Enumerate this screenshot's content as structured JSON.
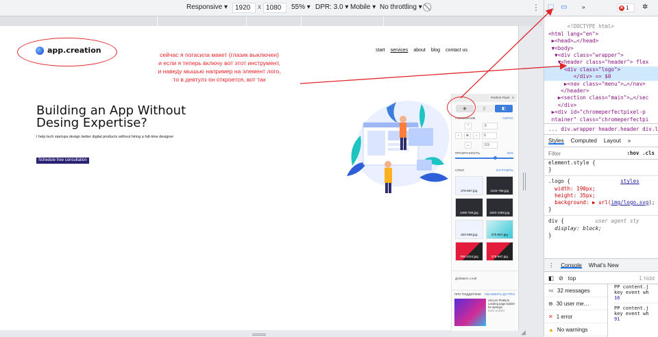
{
  "device_toolbar": {
    "mode": "Responsive ▾",
    "width": "1920",
    "times": "x",
    "height": "1080",
    "zoom": "55% ▾",
    "dpr": "DPR: 3.0 ▾",
    "device": "Mobile ▾",
    "throttle": "No throttling ▾"
  },
  "site": {
    "logo": "app.creation",
    "nav": [
      "start",
      "services",
      "about",
      "blog",
      "contact us"
    ],
    "hero_title": "Building an App Without Desing Expertise?",
    "hero_sub": "I help tech startups design better digital products without hiring a full-time designer",
    "cta": "Schedule free consultation"
  },
  "annotation": {
    "line1": "сейчас я погасила макет (глазик выключен)",
    "line2": "и если я теперь включу вот этот инструмент,",
    "line3": "и наведу мышью например на элемент лого,",
    "line4": "то в девтулз он откроется, вот так"
  },
  "perfect_pixel": {
    "title": "Perfect Pixel",
    "position_label": "ПОЛОЖЕНИЕ",
    "reset": "СБРОС",
    "x": "0",
    "y": "0",
    "scale": "0.5",
    "opacity_label": "ПРОЗРАЧНОСТЬ",
    "opacity_value": "60%",
    "layers_label": "СЛОИ",
    "upload": "ЗАГРУЗИТЬ",
    "thumbs": [
      "375-667.jpg",
      "1024-768.jpg",
      "1366-768.jpg",
      "1920-1080.jpg",
      "320-568.jpg",
      "375-667.jpg",
      "768-1024.jpg",
      "375-667.jpg"
    ],
    "add_layer": "Добавить слой",
    "support": "ПРИ ПОДДЕРЖКЕ",
    "update_pro": "ОБНОВИТЬ ДО PRO",
    "ad_text": "Unicorn Platform. Landing page builder for startups",
    "ad_sub": "Build website"
  },
  "devtools": {
    "tabs_more": "»",
    "error_count": "1",
    "dom": {
      "doctype": "<!DOCTYPE html>",
      "html": "<html lang=\"en\">",
      "head": "▶<head>…</head>",
      "body": "▼<body>",
      "wrapper": "▼<div class=\"wrapper\">",
      "header": "▼<header class=\"header\"> flex",
      "logo": "<div class=\"logo\">",
      "logo_end": "</div> == $0",
      "nav": "▶<nav class=\"menu\">…</nav>",
      "header_end": "</header>",
      "section": "▶<section class=\"main\">…</sec",
      "div_end": "</div>",
      "pp": "▶<div id=\"chromeperfectpixel-p",
      "pp2": "ntainer\" class=\"chromeperfectpi"
    },
    "breadcrumbs": "...  div.wrapper  header.header  div.lo",
    "styles_tabs": [
      "Styles",
      "Computed",
      "Layout",
      "»"
    ],
    "filter_placeholder": "Filter",
    "filter_btns": ":hov  .cls",
    "rules": {
      "element_style": "element.style {",
      "close": "}",
      "logo_sel": ".logo {",
      "logo_src": "styles",
      "width": "width: 190px;",
      "height": "height: 35px;",
      "background_prop": "background: ▶ url(",
      "background_url": "img/logo.svg",
      "background_end": ");",
      "div_sel": "div {",
      "ua": "user agent sty",
      "display": "display: block;"
    },
    "console_tabs": [
      "Console",
      "What's New"
    ],
    "console_context": "top",
    "hidden": "1 hidd",
    "console_side": [
      {
        "icon": "≔",
        "label": "32 messages"
      },
      {
        "icon": "⊖",
        "label": "30 user me…"
      },
      {
        "icon": "✕",
        "label": "1 error"
      },
      {
        "icon": "▲",
        "label": "No warnings"
      }
    ],
    "console_msgs": [
      {
        "a": "PP content.j",
        "b": "key event wh",
        "n": "16"
      },
      {
        "a": "PP content.j",
        "b": "key event wh",
        "n": "91"
      }
    ]
  }
}
